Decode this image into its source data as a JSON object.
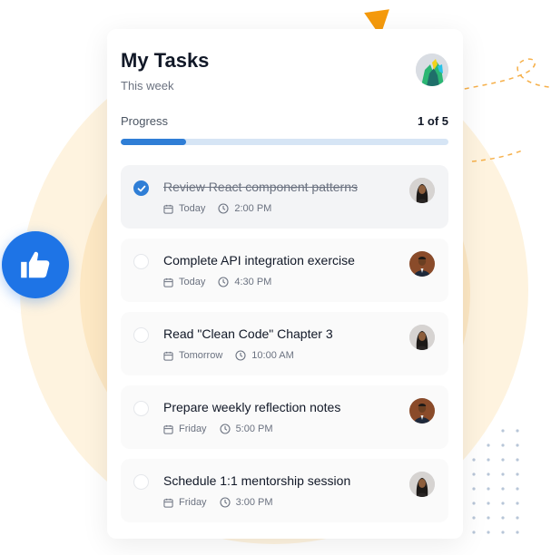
{
  "header": {
    "title": "My Tasks",
    "subtitle": "This week"
  },
  "progress": {
    "label": "Progress",
    "count_text": "1 of 5",
    "completed": 1,
    "total": 5,
    "fill_fraction": 0.2
  },
  "colors": {
    "accent": "#2f7ed6",
    "thumb": "#1e74e6",
    "triangle": "#f59a0c",
    "background_ring": "#fde8c4"
  },
  "tasks": [
    {
      "title": "Review React component patterns",
      "day": "Today",
      "time": "2:00 PM",
      "completed": true
    },
    {
      "title": "Complete API integration exercise",
      "day": "Today",
      "time": "4:30 PM",
      "completed": false
    },
    {
      "title": "Read \"Clean Code\" Chapter 3",
      "day": "Tomorrow",
      "time": "10:00 AM",
      "completed": false
    },
    {
      "title": "Prepare weekly reflection notes",
      "day": "Friday",
      "time": "5:00 PM",
      "completed": false
    },
    {
      "title": "Schedule 1:1 mentorship session",
      "day": "Friday",
      "time": "3:00 PM",
      "completed": false
    }
  ],
  "icons": {
    "date": "calendar-icon",
    "time": "clock-icon",
    "done": "checkmark-icon",
    "decoration": "thumbs-up-icon"
  }
}
